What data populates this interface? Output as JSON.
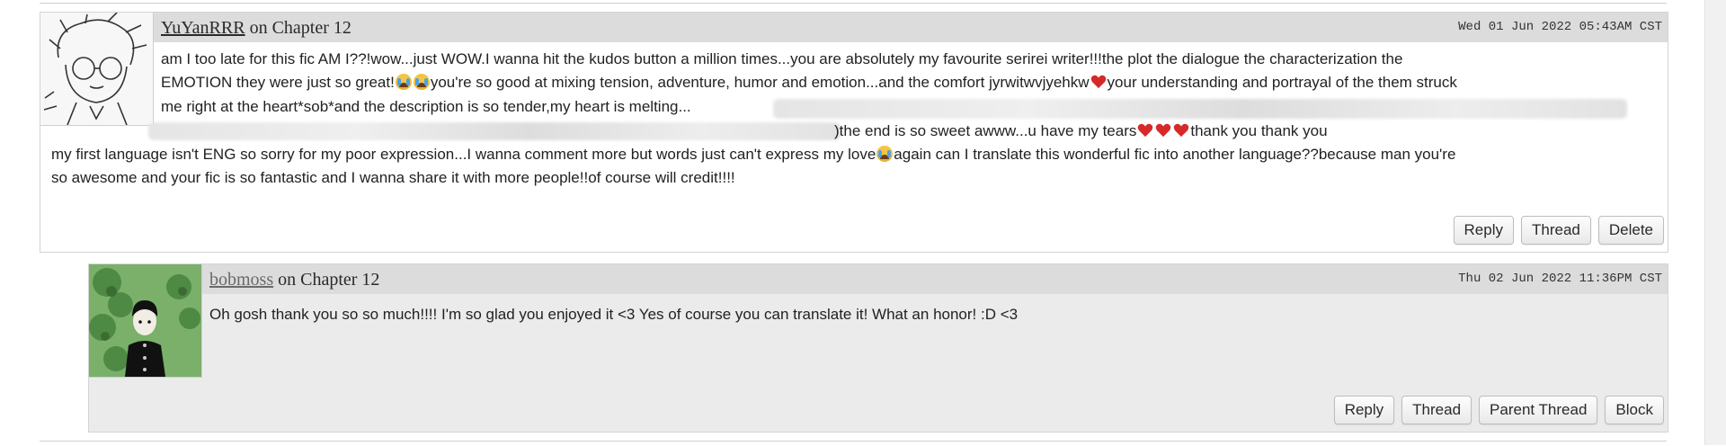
{
  "comment1": {
    "author": "YuYanRRR",
    "on_text": " on Chapter 12",
    "datetime": "Wed 01 Jun 2022 05:43AM CST",
    "lines": [
      "am I too late for this fic AM I??!wow...just WOW.I wanna hit the kudos button a million times...you are absolutely my favourite serirei writer!!!the plot the dialogue the characterization the",
      "EMOTION they were just so great!",
      "you're so good at mixing tension, adventure, humor and emotion...and the comfort jyrwitwvjyehkw",
      "your understanding and portrayal of the them struck",
      "me right at the heart*sob*and the description is so tender,my heart is melting...",
      ")the end is so sweet awww...u have my tears",
      "thank you thank you",
      "my first language isn't ENG so sorry for my poor expression...I wanna comment more but words just can't express my love",
      "again can I translate this wonderful fic into another language??because man you're",
      "so awesome and your fic is so fantastic and I wanna share it with more people!!of course will credit!!!!"
    ],
    "actions": [
      "Reply",
      "Thread",
      "Delete"
    ]
  },
  "comment2": {
    "author": "bobmoss",
    "on_text": " on Chapter 12",
    "datetime": "Thu 02 Jun 2022 11:36PM CST",
    "text": "Oh gosh thank you so so much!!!! I'm so glad you enjoyed it <3 Yes of course you can translate it! What an honor! :D <3",
    "actions": [
      "Reply",
      "Thread",
      "Parent Thread",
      "Block"
    ]
  },
  "icons": {
    "crying": "loudly-crying-face-icon",
    "heart": "red-heart-icon"
  },
  "colors": {
    "heading_bg": "#dcdcdc",
    "reply_bg": "#ebebeb",
    "heart": "#d62a2a",
    "avatar_green": "#7ab06a"
  }
}
